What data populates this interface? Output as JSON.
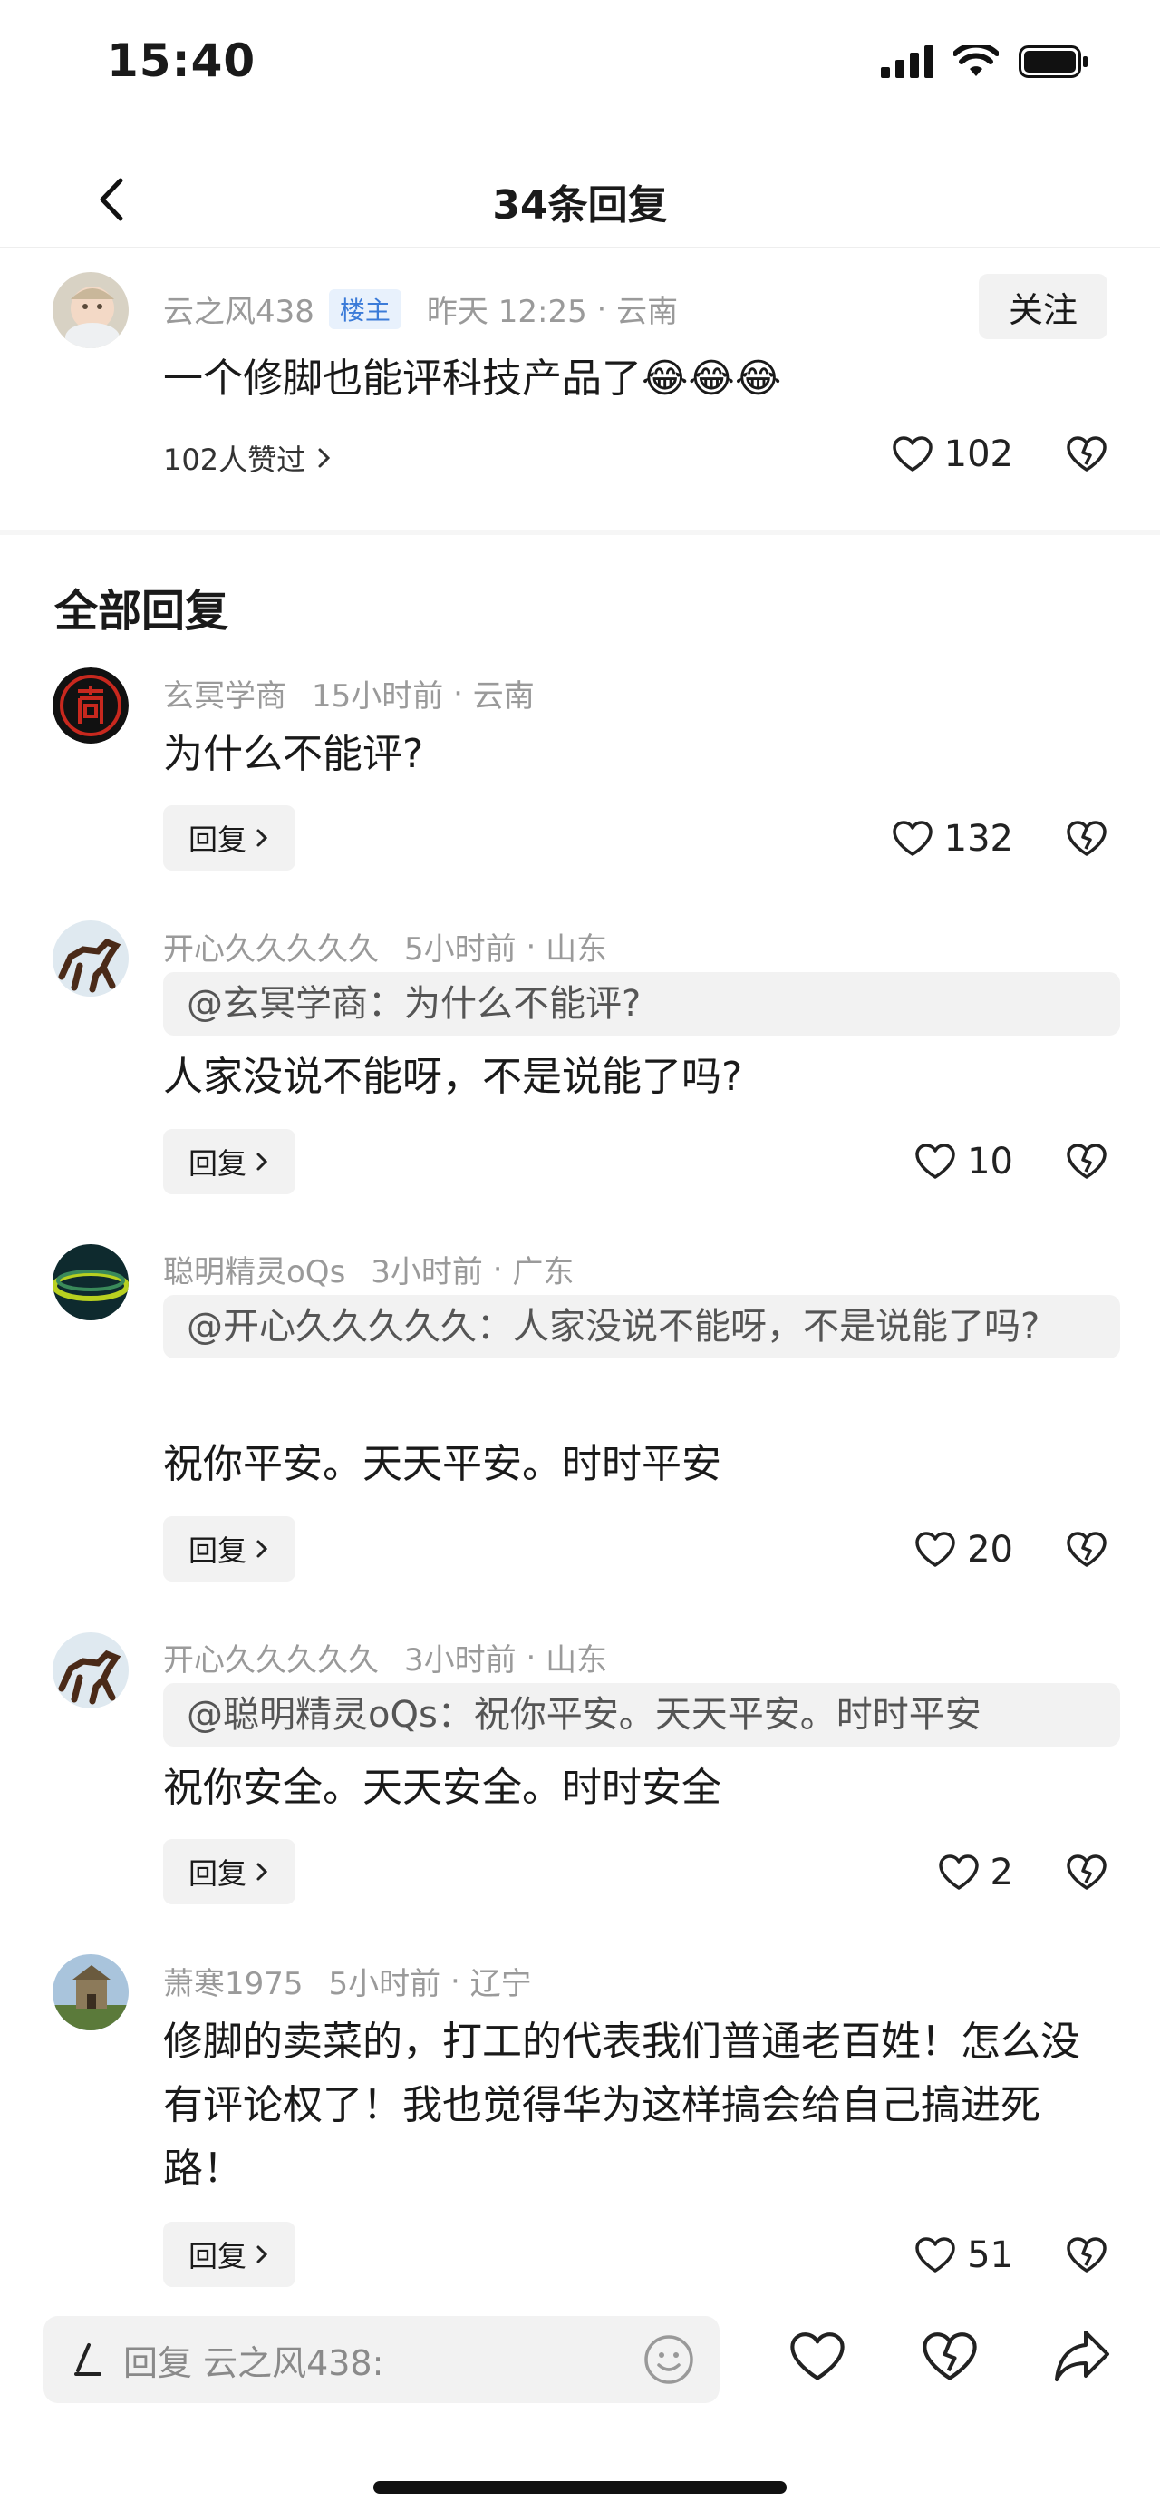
{
  "status_bar": {
    "time": "15:40"
  },
  "nav": {
    "title": "34条回复"
  },
  "main_comment": {
    "username": "云之风438",
    "tag": "楼主",
    "time": "昨天 12:25",
    "location": "云南",
    "follow_label": "关注",
    "text": "一个修脚也能评科技产品了",
    "emoji": "😂😂😂",
    "liked_by": "102人赞过",
    "likes": "102"
  },
  "section_title": "全部回复",
  "reply_label": "回复",
  "replies": [
    {
      "username": "玄冥学商",
      "time": "15小时前",
      "location": "云南",
      "quote": "",
      "text": "为什么不能评?",
      "likes": "132"
    },
    {
      "username": "开心久久久久久",
      "time": "5小时前",
      "location": "山东",
      "quote": "@玄冥学商：为什么不能评?",
      "text": "人家没说不能呀，不是说能了吗?",
      "likes": "10"
    },
    {
      "username": "聪明精灵oQs",
      "time": "3小时前",
      "location": "广东",
      "quote": "@开心久久久久久：人家没说不能呀，不是说能了吗?",
      "text": "祝你平安。天天平安。时时平安",
      "likes": "20"
    },
    {
      "username": "开心久久久久久",
      "time": "3小时前",
      "location": "山东",
      "quote": "@聪明精灵oQs：祝你平安。天天平安。时时平安",
      "text": "祝你安全。天天安全。时时安全",
      "likes": "2"
    },
    {
      "username": "萧寒1975",
      "time": "5小时前",
      "location": "辽宁",
      "quote": "",
      "text": "修脚的卖菜的，打工的代表我们普通老百姓！怎么没有评论权了！我也觉得华为这样搞会给自己搞进死路！",
      "likes": "51"
    }
  ],
  "bottom_bar": {
    "placeholder": "回复 云之风438:"
  },
  "colors": {
    "tag_blue": "#3b7bd8",
    "meta_gray": "#9a9a9a",
    "chip_bg": "#f2f2f2"
  }
}
